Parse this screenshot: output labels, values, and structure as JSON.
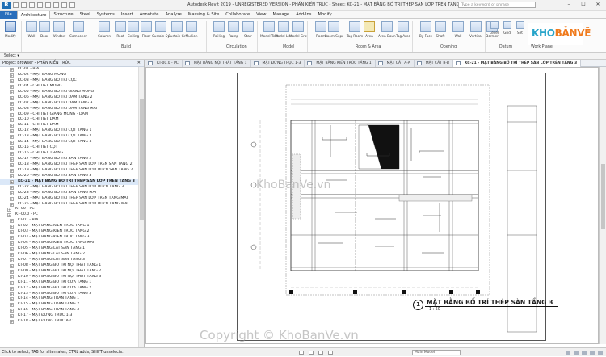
{
  "app": {
    "title": "Autodesk Revit 2019 - UNREGISTERED VERSION - PHẦN KIẾN TRÚC - Sheet: KC-21 - MẶT BẰNG BỐ TRÍ THÉP SÀN LỚP TRÊN TẦNG 3",
    "search_placeholder": "Type a keyword or phrase",
    "logo_letter": "R"
  },
  "ribbon_tabs": [
    "File",
    "Architecture",
    "Structure",
    "Steel",
    "Systems",
    "Insert",
    "Annotate",
    "Analyze",
    "Massing & Site",
    "Collaborate",
    "View",
    "Manage",
    "Add-Ins",
    "Modify"
  ],
  "ribbon": {
    "buttons": [
      {
        "label": "Modify",
        "name": "modify"
      },
      {
        "label": "Wall",
        "name": "wall"
      },
      {
        "label": "Door",
        "name": "door"
      },
      {
        "label": "Window",
        "name": "window"
      },
      {
        "label": "Component",
        "name": "component"
      },
      {
        "label": "Column",
        "name": "column"
      },
      {
        "label": "Roof",
        "name": "roof"
      },
      {
        "label": "Ceiling",
        "name": "ceiling"
      },
      {
        "label": "Floor",
        "name": "floor"
      },
      {
        "label": "Curtain System",
        "name": "curtain-system"
      },
      {
        "label": "Curtain Grid",
        "name": "curtain-grid"
      },
      {
        "label": "Mullion",
        "name": "mullion"
      },
      {
        "label": "Railing",
        "name": "railing"
      },
      {
        "label": "Ramp",
        "name": "ramp"
      },
      {
        "label": "Stair",
        "name": "stair"
      },
      {
        "label": "Model Text",
        "name": "model-text"
      },
      {
        "label": "Model Line",
        "name": "model-line"
      },
      {
        "label": "Model Group",
        "name": "model-group"
      },
      {
        "label": "Room",
        "name": "room"
      },
      {
        "label": "Room Separator",
        "name": "room-separator"
      },
      {
        "label": "Tag Room",
        "name": "tag-room"
      },
      {
        "label": "Area",
        "name": "area"
      },
      {
        "label": "Area Boundary",
        "name": "area-boundary"
      },
      {
        "label": "Tag Area",
        "name": "tag-area"
      },
      {
        "label": "By Face",
        "name": "by-face"
      },
      {
        "label": "Shaft",
        "name": "shaft"
      },
      {
        "label": "Wall",
        "name": "wall-opening"
      },
      {
        "label": "Vertical",
        "name": "vertical"
      },
      {
        "label": "Dormer",
        "name": "dormer"
      },
      {
        "label": "Level",
        "name": "level"
      },
      {
        "label": "Grid",
        "name": "grid"
      },
      {
        "label": "Set",
        "name": "set"
      }
    ],
    "panels": [
      "Build",
      "Circulation",
      "Model",
      "Room & Area",
      "Opening",
      "Datum",
      "Work Plane"
    ]
  },
  "select_label": "Select",
  "browser": {
    "title": "Project Browser - PHẦN KIẾN TRÚC",
    "items": [
      {
        "label": "KC-01 - BÌA",
        "kind": "leaf"
      },
      {
        "label": "KC-02 - MẶT BẰNG MÓNG",
        "kind": "leaf"
      },
      {
        "label": "KC-03 - MẶT BẰNG BỐ TRÍ CỌC",
        "kind": "leaf"
      },
      {
        "label": "KC-04 - CHI TIẾT MÓNG",
        "kind": "leaf"
      },
      {
        "label": "KC-05 - MẶT BẰNG BỐ TRÍ GIẰNG MÓNG",
        "kind": "leaf"
      },
      {
        "label": "KC-06 - MẶT BẰNG BỐ TRÍ DẦM TẦNG 2",
        "kind": "leaf"
      },
      {
        "label": "KC-07 - MẶT BẰNG BỐ TRÍ DẦM TẦNG 3",
        "kind": "leaf"
      },
      {
        "label": "KC-08 - MẶT BẰNG BỐ TRÍ DẦM TẦNG MÁI",
        "kind": "leaf"
      },
      {
        "label": "KC-09 - CHI TIẾT GIẰNG MÓNG - DẦM",
        "kind": "leaf"
      },
      {
        "label": "KC-10 - CHI TIẾT DẦM",
        "kind": "leaf"
      },
      {
        "label": "KC-11 - CHI TIẾT DẦM",
        "kind": "leaf"
      },
      {
        "label": "KC-12 - MẶT BẰNG BỐ TRÍ CỘT TẦNG 1",
        "kind": "leaf"
      },
      {
        "label": "KC-13 - MẶT BẰNG BỐ TRÍ CỘT TẦNG 2",
        "kind": "leaf"
      },
      {
        "label": "KC-14 - MẶT BẰNG BỐ TRÍ CỘT TẦNG 3",
        "kind": "leaf"
      },
      {
        "label": "KC-15 - CHI TIẾT CỘT",
        "kind": "leaf"
      },
      {
        "label": "KC-16 - CHI TIẾT THANG",
        "kind": "leaf"
      },
      {
        "label": "KC-17 - MẶT BẰNG BỐ TRÍ SÀN TẦNG 2",
        "kind": "leaf"
      },
      {
        "label": "KC-18 - MẶT BẰNG BỐ TRÍ THÉP SÀN LỚP TRÊN SÀN TẦNG 2",
        "kind": "leaf"
      },
      {
        "label": "KC-19 - MẶT BẰNG BỐ TRÍ THÉP SÀN LỚP DƯỚI SÀN TẦNG 2",
        "kind": "leaf"
      },
      {
        "label": "KC-20 - MẶT BẰNG BỐ TRÍ SÀN TẦNG 3",
        "kind": "leaf"
      },
      {
        "label": "KC-21 - MẶT BẰNG BỐ TRÍ THÉP SÀN LỚP TRÊN TẦNG 3",
        "kind": "selected"
      },
      {
        "label": "KC-22 - MẶT BẰNG BỐ TRÍ THÉP SÀN LỚP DƯỚI TẦNG 3",
        "kind": "leaf"
      },
      {
        "label": "KC-23 - MẶT BẰNG BỐ TRÍ SÀN TẦNG MÁI",
        "kind": "leaf"
      },
      {
        "label": "KC-24 - MẶT BẰNG BỐ TRÍ THÉP SÀN LỚP TRÊN TẦNG MÁI",
        "kind": "leaf"
      },
      {
        "label": "KC-25 - MẶT BẰNG BỐ TRÍ THÉP SÀN LỚP DƯỚI TẦNG MÁI",
        "kind": "leaf"
      },
      {
        "label": "KT-00 - PC",
        "kind": "group"
      },
      {
        "label": "KT-00.0 - PC",
        "kind": "group"
      },
      {
        "label": "KT-01 - BÌA",
        "kind": "leaf"
      },
      {
        "label": "KT-02 - MẶT BẰNG KIẾN TRÚC TẦNG 1",
        "kind": "leaf"
      },
      {
        "label": "KT-03 - MẶT BẰNG KIẾN TRÚC TẦNG 2",
        "kind": "leaf"
      },
      {
        "label": "KT-03 - MẶT BẰNG KIẾN TRÚC TẦNG 3",
        "kind": "leaf"
      },
      {
        "label": "KT-04 - MẶT BẰNG KIẾN TRÚC TẦNG MÁI",
        "kind": "leaf"
      },
      {
        "label": "KT-05 - MẶT BẰNG LÁT SÀN TẦNG 1",
        "kind": "leaf"
      },
      {
        "label": "KT-06 - MẶT BẰNG LÁT SÀN TẦNG 2",
        "kind": "leaf"
      },
      {
        "label": "KT-07 - MẶT BẰNG LÁT SÀN TẦNG 3",
        "kind": "leaf"
      },
      {
        "label": "KT-08 - MẶT BẰNG BỐ TRÍ NỘI THẤT TẦNG 1",
        "kind": "leaf"
      },
      {
        "label": "KT-09 - MẶT BẰNG BỐ TRÍ NỘI THẤT TẦNG 2",
        "kind": "leaf"
      },
      {
        "label": "KT-10 - MẶT BẰNG BỐ TRÍ NỘI THẤT TẦNG 3",
        "kind": "leaf"
      },
      {
        "label": "KT-11 - MẶT BẰNG BỐ TRÍ CỬA TẦNG 1",
        "kind": "leaf"
      },
      {
        "label": "KT-12 - MẶT BẰNG BỐ TRÍ CỬA TẦNG 2",
        "kind": "leaf"
      },
      {
        "label": "KT-13 - MẶT BẰNG BỐ TRÍ CỬA TẦNG 3",
        "kind": "leaf"
      },
      {
        "label": "KT-14 - MẶT BẰNG TRẦN TẦNG 1",
        "kind": "leaf"
      },
      {
        "label": "KT-15 - MẶT BẰNG TRẦN TẦNG 2",
        "kind": "leaf"
      },
      {
        "label": "KT-16 - MẶT BẰNG TRẦN TẦNG 3",
        "kind": "leaf"
      },
      {
        "label": "KT-17 - MẶT ĐỨNG TRỤC 1-3",
        "kind": "leaf"
      },
      {
        "label": "KT-18 - MẶT ĐỨNG TRỤC A-C",
        "kind": "leaf"
      }
    ]
  },
  "doc_tabs": [
    {
      "label": "KT-00.0 - PC",
      "active": false
    },
    {
      "label": "MẶT BẰNG NỘI THẤT TẦNG 1",
      "active": false
    },
    {
      "label": "MẶT ĐỨNG TRỤC 1-3",
      "active": false
    },
    {
      "label": "MẶT BẰNG KIẾN TRÚC TẦNG 1",
      "active": false
    },
    {
      "label": "MẶT CẮT A-A",
      "active": false
    },
    {
      "label": "MẶT CẮT B-B",
      "active": false
    },
    {
      "label": "KC-21 - MẶT BẰNG BỐ TRÍ THÉP SÀN LỚP TRÊN TẦNG 3",
      "active": true
    }
  ],
  "view_title": {
    "number": "1",
    "name": "MẶT BẰNG BỐ TRÍ THÉP SÀN TẦNG 3",
    "scale": "1 : 50"
  },
  "watermarks": {
    "canvas": "KhoBanVe.vn",
    "copyright": "Copyright © KhoBanVe.vn",
    "brand_kho": "KHO",
    "brand_ban": "BẢNVẼ"
  },
  "status": {
    "text": "Click to select, TAB for alternates, CTRL adds, SHIFT unselects.",
    "sub": "DAT VE KEY STENU",
    "model": "Main Model"
  },
  "colors": {
    "file_tab": "#2a6ebb",
    "brand_blue": "#26a4c9",
    "brand_orange": "#f07a1c",
    "selected_row": "#dbe8f8"
  }
}
